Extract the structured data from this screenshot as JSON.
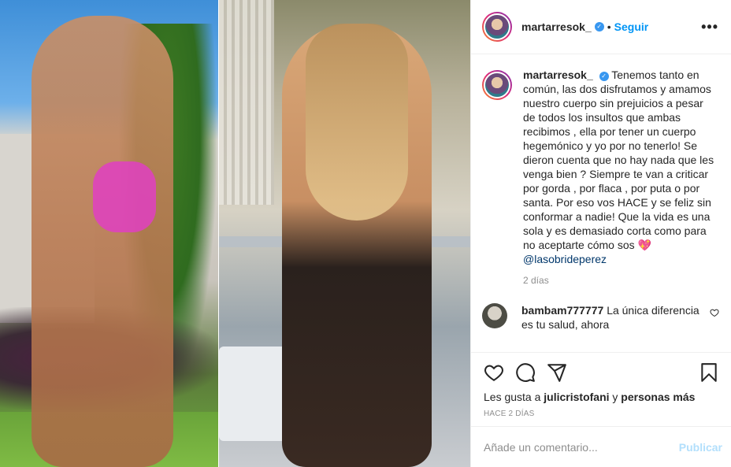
{
  "post": {
    "author": "martarresok_",
    "follow_label": "Seguir",
    "separator": "•",
    "more_label": "•••",
    "verified_mark": "✓"
  },
  "caption": {
    "author": "martarresok_",
    "text": "Tenemos tanto en común, las dos disfrutamos y amamos nuestro cuerpo sin prejuicios a pesar de todos los insultos que ambas recibimos , ella por tener un cuerpo hegemónico y yo por no tenerlo! Se dieron cuenta que no hay nada que les venga bien ? Siempre te van a criticar por gorda , por flaca , por puta o por santa. Por eso vos HACE y se feliz sin conformar a nadie! Que la vida es una sola y es demasiado corta como para no aceptarte cómo sos",
    "emoji": "💖",
    "mention": "@lasobrideperez",
    "time": "2 días"
  },
  "comments": [
    {
      "author": "bambam777777",
      "text": "La única diferencia es tu salud, ahora"
    }
  ],
  "likes": {
    "prefix": "Les gusta a",
    "user": "julicristofani",
    "connector": "y",
    "others": "personas más"
  },
  "timestamp": "Hace 2 días",
  "comment_box": {
    "placeholder": "Añade un comentario...",
    "publish_label": "Publicar"
  },
  "icons": {
    "like": "heart-icon",
    "comment": "comment-bubble-icon",
    "share": "paper-plane-icon",
    "save": "bookmark-icon",
    "comment_like": "small-heart-icon"
  },
  "colors": {
    "link_blue": "#0095f6",
    "text": "#262626",
    "muted": "#8e8e8e",
    "publish_disabled": "#b2dffc",
    "mention": "#00376b"
  }
}
